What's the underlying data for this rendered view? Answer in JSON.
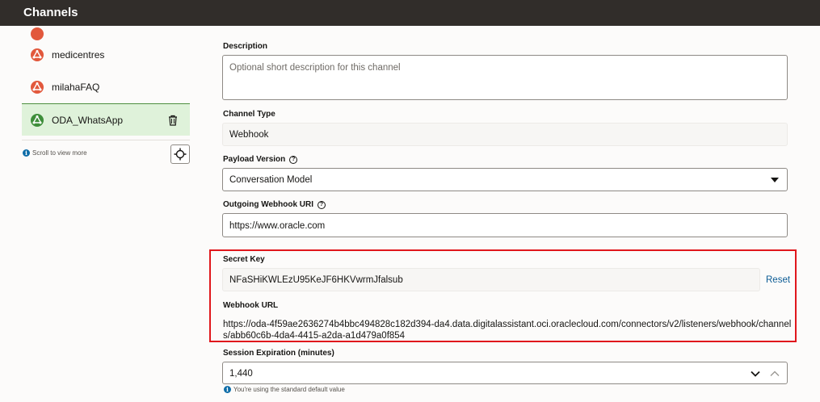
{
  "header": {
    "title": "Channels"
  },
  "sidebar": {
    "items": [
      {
        "label": "medicentres"
      },
      {
        "label": "milahaFAQ"
      },
      {
        "label": "ODA_WhatsApp"
      }
    ],
    "scroll_hint": "Scroll to view more"
  },
  "form": {
    "description": {
      "label": "Description",
      "placeholder": "Optional short description for this channel"
    },
    "channel_type": {
      "label": "Channel Type",
      "value": "Webhook"
    },
    "payload_version": {
      "label": "Payload Version",
      "value": "Conversation Model"
    },
    "outgoing_uri": {
      "label": "Outgoing Webhook URI",
      "value": "https://www.oracle.com"
    },
    "secret_key": {
      "label": "Secret Key",
      "value": "NFaSHiKWLEzU95KeJF6HKVwrmJfalsub",
      "reset_label": "Reset"
    },
    "webhook_url": {
      "label": "Webhook URL",
      "value": "https://oda-4f59ae2636274b4bbc494828c182d394-da4.data.digitalassistant.oci.oraclecloud.com/connectors/v2/listeners/webhook/channels/abb60c6b-4da4-4415-a2da-a1d479a0f854"
    },
    "session_expiration": {
      "label": "Session Expiration (minutes)",
      "value": "1,440",
      "note": "You're using the standard default value"
    }
  },
  "colors": {
    "accent": "#e0171c",
    "selected_bg": "#dff2da",
    "channel_icon": "#e2583c",
    "selected_icon": "#3e8e3a"
  }
}
